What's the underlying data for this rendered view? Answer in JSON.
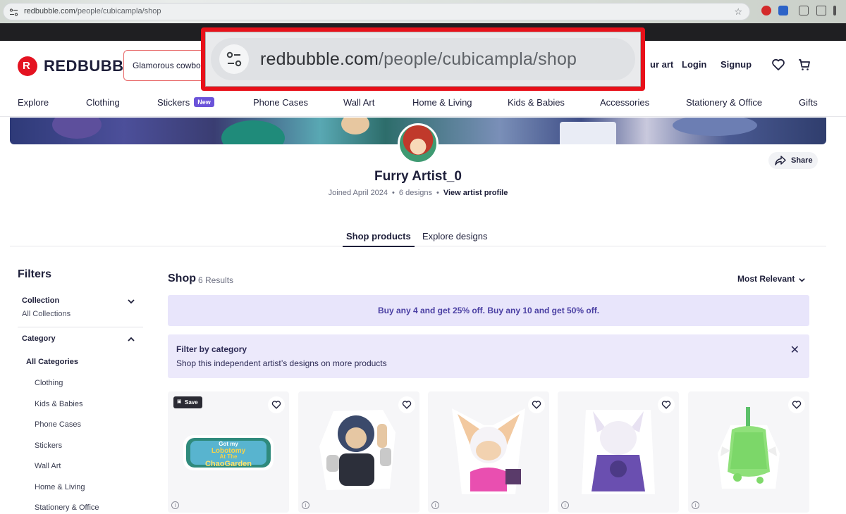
{
  "browser": {
    "url_host": "redbubble.com",
    "url_path": "/people/cubicampla/shop"
  },
  "callout": {
    "url_host": "redbubble.com",
    "url_path": "/people/cubicampla/shop"
  },
  "header": {
    "logo_text": "REDBUBBLE",
    "search_value": "Glamorous cowboy",
    "sell_label": "ur art",
    "login_label": "Login",
    "signup_label": "Signup"
  },
  "nav": {
    "items": [
      "Explore",
      "Clothing",
      "Stickers",
      "Phone Cases",
      "Wall Art",
      "Home & Living",
      "Kids & Babies",
      "Accessories",
      "Stationery & Office",
      "Gifts"
    ],
    "new_badge": "New"
  },
  "profile": {
    "name": "Furry Artist_0",
    "joined": "Joined April 2024",
    "designs": "6 designs",
    "view_profile": "View artist profile",
    "share_label": "Share"
  },
  "tabs": {
    "shop_products": "Shop products",
    "explore_designs": "Explore designs"
  },
  "filters": {
    "title": "Filters",
    "collection_label": "Collection",
    "collection_value": "All Collections",
    "category_label": "Category",
    "all_categories": "All Categories",
    "categories": [
      "Clothing",
      "Kids & Babies",
      "Phone Cases",
      "Stickers",
      "Wall Art",
      "Home & Living",
      "Stationery & Office"
    ]
  },
  "shop": {
    "title": "Shop",
    "results": "6 Results",
    "sort_label": "Most Relevant",
    "promo": "Buy any 4 and get 25% off.  Buy any 10 and get 50% off.",
    "filter_by_category_title": "Filter by category",
    "filter_by_category_sub": "Shop this independent artist’s designs on more products",
    "save_label": "Save",
    "sticker1_lines": [
      "Got my",
      "Lobotomy",
      "At The",
      "ChaoGarden"
    ]
  },
  "colors": {
    "brand_red": "#e41321",
    "accent_purple": "#6b53d9",
    "promo_bg": "#e8e5fb",
    "text_dark": "#1e1f3a"
  }
}
